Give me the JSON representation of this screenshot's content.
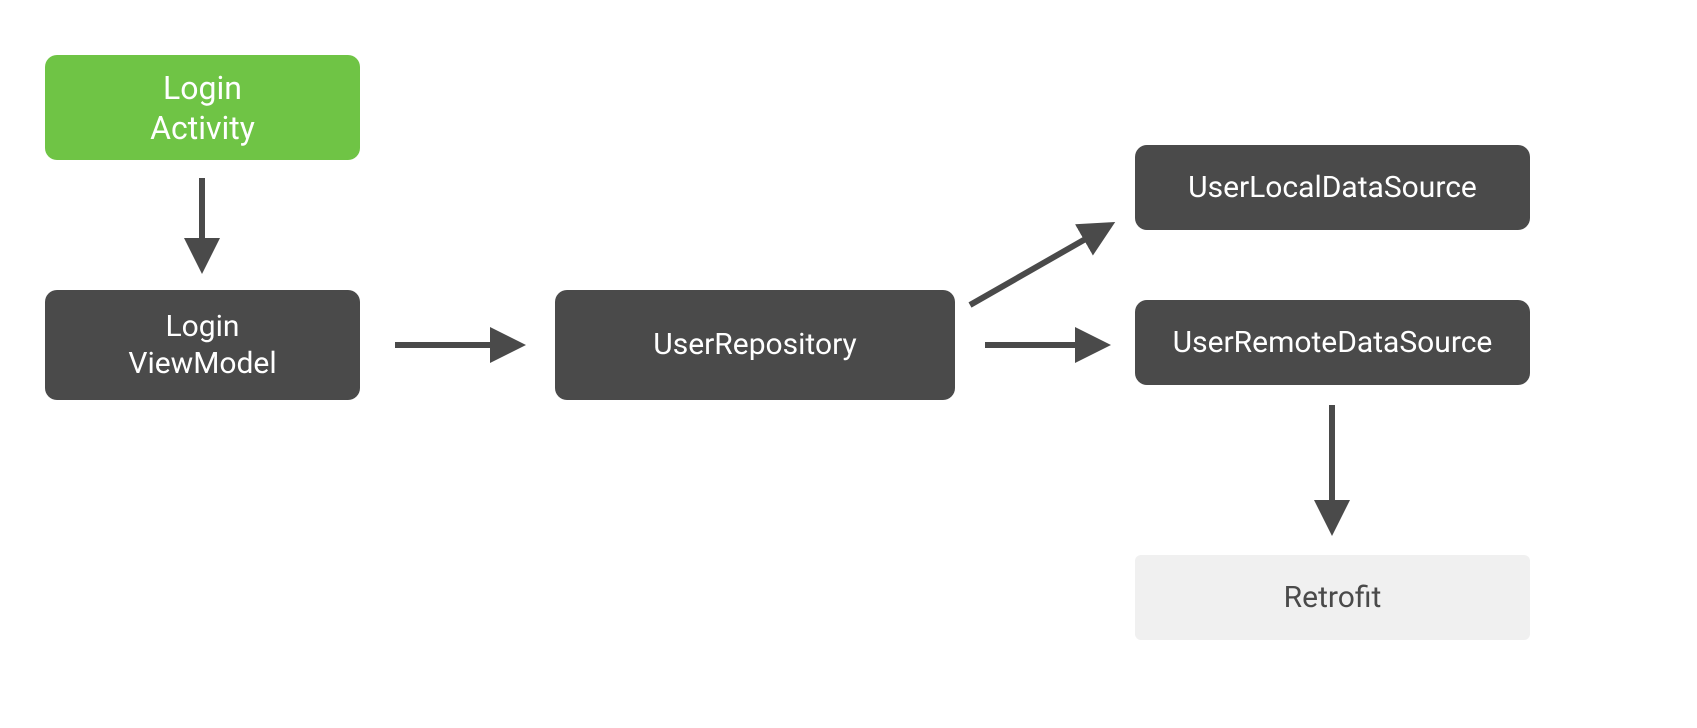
{
  "diagram": {
    "nodes": {
      "login_activity": {
        "line1": "Login",
        "line2": "Activity"
      },
      "login_viewmodel": {
        "line1": "Login",
        "line2": "ViewModel"
      },
      "user_repository": "UserRepository",
      "user_local_ds": "UserLocalDataSource",
      "user_remote_ds": "UserRemoteDataSource",
      "retrofit": "Retrofit"
    },
    "colors": {
      "green": "#6fc445",
      "dark": "#4a4a4a",
      "light": "#f0f0f0",
      "arrow": "#4a4a4a"
    },
    "edges": [
      {
        "from": "login_activity",
        "to": "login_viewmodel"
      },
      {
        "from": "login_viewmodel",
        "to": "user_repository"
      },
      {
        "from": "user_repository",
        "to": "user_local_ds"
      },
      {
        "from": "user_repository",
        "to": "user_remote_ds"
      },
      {
        "from": "user_remote_ds",
        "to": "retrofit"
      }
    ]
  }
}
